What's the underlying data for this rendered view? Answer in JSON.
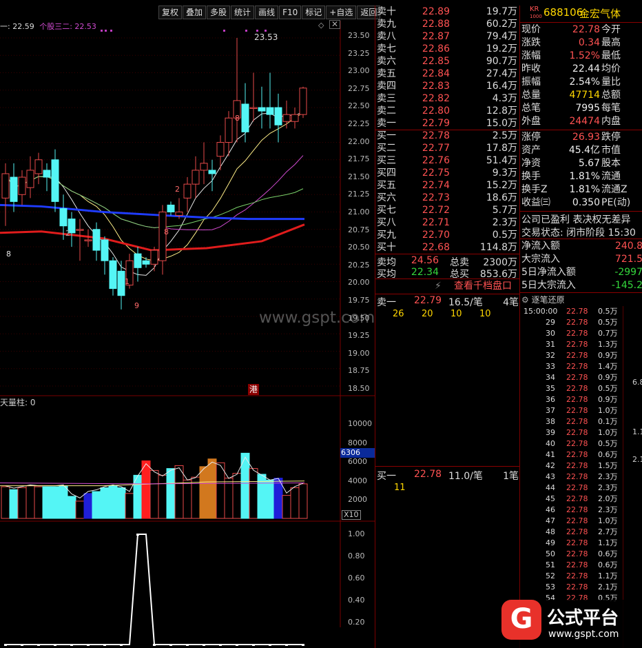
{
  "toolbar": [
    "复权",
    "叠加",
    "多股",
    "统计",
    "画线",
    "F10",
    "标记",
    "+自选",
    "返回"
  ],
  "chart": {
    "ma_label": "一: 22.59",
    "ma2_label": "个股三二: 22.53",
    "high_label": "23.53",
    "price_ticks": [
      "23.50",
      "23.25",
      "23.00",
      "22.75",
      "22.50",
      "22.25",
      "22.00",
      "21.75",
      "21.50",
      "21.25",
      "21.00",
      "20.75",
      "20.50",
      "20.25",
      "20.00",
      "19.75",
      "19.50",
      "19.25",
      "19.00",
      "18.75",
      "18.50"
    ],
    "markers": [
      "2",
      "8",
      "1",
      "8",
      "9",
      "2",
      "8"
    ],
    "watermark": "www.gspt.com",
    "hk_badge": "港",
    "vol_title": "天量柱: 0",
    "vol_ticks": [
      "10000",
      "8000",
      "6000",
      "4000",
      "2000"
    ],
    "vol_flag": "6306",
    "vol_mult": "X10",
    "ind_ticks": [
      "1.00",
      "0.80",
      "0.60",
      "0.40",
      "0.20"
    ]
  },
  "chart_data": {
    "type": "candlestick",
    "ylim": [
      18.5,
      23.53
    ],
    "candles": [
      [
        21.2,
        21.55,
        21.7,
        20.8
      ],
      [
        21.5,
        21.15,
        21.7,
        21.0
      ],
      [
        21.25,
        21.5,
        21.6,
        21.1
      ],
      [
        21.35,
        21.6,
        21.8,
        21.2
      ],
      [
        21.55,
        21.75,
        21.85,
        21.4
      ],
      [
        21.6,
        21.5,
        21.7,
        21.3
      ],
      [
        21.75,
        21.15,
        21.9,
        21.0
      ],
      [
        21.05,
        20.8,
        21.25,
        20.6
      ],
      [
        20.9,
        20.7,
        21.0,
        20.5
      ],
      [
        20.75,
        20.75,
        20.9,
        20.3
      ],
      [
        20.6,
        20.6,
        20.75,
        20.5
      ],
      [
        20.75,
        20.45,
        20.85,
        20.3
      ],
      [
        20.6,
        20.3,
        20.65,
        20.1
      ],
      [
        20.3,
        19.9,
        20.35,
        19.8
      ],
      [
        20.15,
        19.8,
        20.3,
        19.6
      ],
      [
        19.95,
        20.3,
        20.4,
        19.9
      ],
      [
        20.4,
        20.2,
        20.5,
        20.0
      ],
      [
        20.3,
        20.25,
        20.35,
        20.2
      ],
      [
        20.25,
        20.45,
        20.5,
        20.15
      ],
      [
        20.3,
        21.0,
        21.1,
        20.1
      ],
      [
        21.1,
        21.0,
        21.15,
        20.95
      ],
      [
        20.95,
        21.0,
        21.2,
        20.9
      ],
      [
        21.2,
        21.4,
        21.5,
        21.0
      ],
      [
        21.4,
        21.6,
        21.8,
        21.2
      ],
      [
        21.6,
        21.7,
        22.0,
        21.4
      ],
      [
        21.6,
        21.55,
        21.75,
        21.3
      ],
      [
        21.8,
        22.0,
        22.1,
        21.6
      ],
      [
        22.0,
        22.35,
        22.45,
        21.8
      ],
      [
        22.35,
        22.6,
        23.5,
        22.0
      ],
      [
        22.55,
        22.15,
        22.85,
        22.0
      ],
      [
        22.5,
        22.5,
        23.0,
        22.3
      ],
      [
        22.5,
        22.45,
        22.8,
        22.2
      ],
      [
        22.5,
        22.4,
        23.0,
        22.2
      ],
      [
        22.5,
        22.25,
        22.7,
        22.0
      ],
      [
        22.3,
        22.4,
        22.6,
        22.2
      ],
      [
        22.3,
        22.4,
        22.5,
        22.2
      ],
      [
        22.4,
        22.78,
        22.8,
        22.35
      ]
    ],
    "volume": [
      3300,
      3000,
      3200,
      3400,
      3300,
      3300,
      3300,
      3400,
      2300,
      1800,
      2600,
      2800,
      3200,
      3400,
      3200,
      2600,
      4500,
      6000,
      5000,
      4500,
      5200,
      5500,
      4000,
      4300,
      5400,
      6200,
      5800,
      4200,
      4700,
      6800,
      5200,
      4600,
      4000,
      4200,
      2400,
      3200,
      3600,
      2500
    ],
    "indicator": [
      0,
      0,
      0,
      0,
      0,
      0,
      0,
      0,
      0,
      0,
      0,
      0,
      0,
      0,
      0,
      0,
      1,
      1,
      0,
      0,
      0,
      0,
      0,
      0,
      0,
      0,
      0,
      0,
      0,
      0,
      0,
      0,
      0,
      0,
      0,
      0,
      0,
      0
    ]
  },
  "orderbook": {
    "asks": [
      {
        "label": "卖十",
        "price": "22.89",
        "vol": "19.7万"
      },
      {
        "label": "卖九",
        "price": "22.88",
        "vol": "60.2万"
      },
      {
        "label": "卖八",
        "price": "22.87",
        "vol": "79.4万"
      },
      {
        "label": "卖七",
        "price": "22.86",
        "vol": "19.2万"
      },
      {
        "label": "卖六",
        "price": "22.85",
        "vol": "90.7万"
      },
      {
        "label": "卖五",
        "price": "22.84",
        "vol": "27.4万"
      },
      {
        "label": "卖四",
        "price": "22.83",
        "vol": "16.4万"
      },
      {
        "label": "卖三",
        "price": "22.82",
        "vol": "4.3万"
      },
      {
        "label": "卖二",
        "price": "22.80",
        "vol": "12.8万"
      },
      {
        "label": "卖一",
        "price": "22.79",
        "vol": "15.0万"
      }
    ],
    "bids": [
      {
        "label": "买一",
        "price": "22.78",
        "vol": "2.5万"
      },
      {
        "label": "买二",
        "price": "22.77",
        "vol": "17.8万"
      },
      {
        "label": "买三",
        "price": "22.76",
        "vol": "51.4万"
      },
      {
        "label": "买四",
        "price": "22.75",
        "vol": "9.3万"
      },
      {
        "label": "买五",
        "price": "22.74",
        "vol": "15.2万"
      },
      {
        "label": "买六",
        "price": "22.73",
        "vol": "18.6万"
      },
      {
        "label": "买七",
        "price": "22.72",
        "vol": "5.7万"
      },
      {
        "label": "买八",
        "price": "22.71",
        "vol": "2.3万"
      },
      {
        "label": "买九",
        "price": "22.70",
        "vol": "0.5万"
      },
      {
        "label": "买十",
        "price": "22.68",
        "vol": "114.8万"
      }
    ],
    "sell_avg_label": "卖均",
    "sell_avg": "24.56",
    "total_sell_label": "总卖",
    "total_sell": "2300万",
    "buy_avg_label": "买均",
    "buy_avg": "22.34",
    "total_buy_label": "总买",
    "total_buy": "853.6万",
    "qiandang": "查看千档盘口",
    "ask1_label": "卖一",
    "ask1_price": "22.79",
    "ask1_per": "16.5/笔",
    "ask1_count": "4笔",
    "ask1_queue": [
      "26",
      "20",
      "10",
      "10"
    ],
    "bid1_label": "买一",
    "bid1_price": "22.78",
    "bid1_per": "11.0/笔",
    "bid1_count": "1笔",
    "bid1_queue": [
      "11"
    ]
  },
  "stock": {
    "badge": "KR",
    "badge_sub": "1000",
    "code": "688106",
    "name": "金宏气体"
  },
  "info": [
    {
      "l": "现价",
      "v": "22.78",
      "c": "red",
      "r": "今开"
    },
    {
      "l": "涨跌",
      "v": "0.34",
      "c": "red",
      "r": "最高"
    },
    {
      "l": "涨幅",
      "v": "1.52%",
      "c": "red",
      "r": "最低"
    },
    {
      "l": "昨收",
      "v": "22.44",
      "c": "white",
      "r": "均价"
    },
    {
      "l": "振幅",
      "v": "2.54%",
      "c": "white",
      "r": "量比"
    },
    {
      "l": "总量",
      "v": "47714",
      "c": "yellow",
      "r": "总额"
    },
    {
      "l": "总笔",
      "v": "7995",
      "c": "white",
      "r": "每笔"
    },
    {
      "l": "外盘",
      "v": "24474",
      "c": "red",
      "r": "内盘"
    },
    {
      "l": "涨停",
      "v": "26.93",
      "c": "red",
      "r": "跌停"
    },
    {
      "l": "资产",
      "v": "45.4亿",
      "c": "white",
      "r": "市值"
    },
    {
      "l": "净资",
      "v": "5.67",
      "c": "white",
      "r": "股本"
    },
    {
      "l": "换手",
      "v": "1.81%",
      "c": "white",
      "r": "流通"
    },
    {
      "l": "换手Z",
      "v": "1.81%",
      "c": "white",
      "r": "流通Z"
    },
    {
      "l": "收益㈢",
      "v": "0.350",
      "c": "white",
      "r": "PE(动)"
    }
  ],
  "status": {
    "profit": "公司已盈利 表决权无差异",
    "trade_state": "交易状态: 闭市阶段 15:30"
  },
  "flows": [
    {
      "l": "净流入额",
      "v": "240.8",
      "c": "red"
    },
    {
      "l": "大宗流入",
      "v": "721.5",
      "c": "red"
    },
    {
      "l": "5日净流入额",
      "v": "-2997",
      "c": "green"
    },
    {
      "l": "5日大宗流入",
      "v": "-145.2",
      "c": "green"
    }
  ],
  "ticks_title": "逐笔还原",
  "ticks": [
    [
      "15:00:00",
      "22.78",
      "0.5万"
    ],
    [
      "29",
      "22.78",
      "0.5万"
    ],
    [
      "30",
      "22.78",
      "0.7万"
    ],
    [
      "31",
      "22.78",
      "1.3万"
    ],
    [
      "32",
      "22.78",
      "0.9万"
    ],
    [
      "33",
      "22.78",
      "1.4万"
    ],
    [
      "34",
      "22.78",
      "0.9万"
    ],
    [
      "35",
      "22.78",
      "0.5万"
    ],
    [
      "36",
      "22.78",
      "0.9万"
    ],
    [
      "37",
      "22.78",
      "1.0万"
    ],
    [
      "38",
      "22.78",
      "0.1万"
    ],
    [
      "39",
      "22.78",
      "1.0万"
    ],
    [
      "40",
      "22.78",
      "0.5万"
    ],
    [
      "41",
      "22.78",
      "0.6万"
    ],
    [
      "42",
      "22.78",
      "1.5万"
    ],
    [
      "43",
      "22.78",
      "2.3万"
    ],
    [
      "44",
      "22.78",
      "2.3万"
    ],
    [
      "45",
      "22.78",
      "2.0万"
    ],
    [
      "46",
      "22.78",
      "2.3万"
    ],
    [
      "47",
      "22.78",
      "1.0万"
    ],
    [
      "48",
      "22.78",
      "2.7万"
    ],
    [
      "49",
      "22.78",
      "1.1万"
    ],
    [
      "50",
      "22.78",
      "0.6万"
    ],
    [
      "51",
      "22.78",
      "0.6万"
    ],
    [
      "52",
      "22.78",
      "1.1万"
    ],
    [
      "53",
      "22.78",
      "2.1万"
    ],
    [
      "54",
      "22.78",
      "0.5万"
    ]
  ],
  "right_edge": [
    "6.8",
    "1.1",
    "2.1"
  ],
  "logo": {
    "brand": "公式平台",
    "url": "www.gspt.com"
  }
}
